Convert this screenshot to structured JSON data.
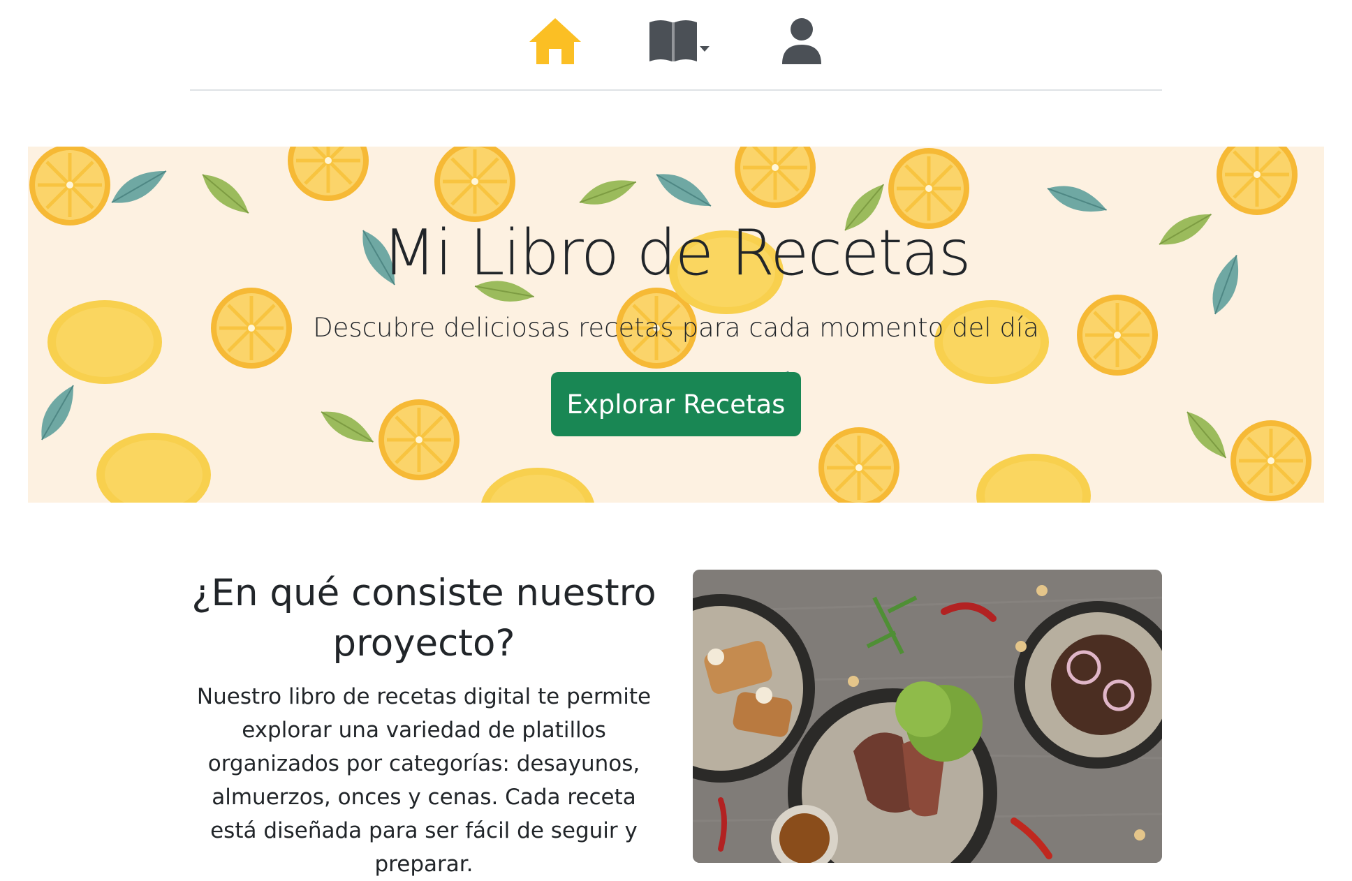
{
  "nav": {
    "home_icon": "home-icon",
    "recipes_icon": "book-open-icon",
    "recipes_dropdown_icon": "caret-down-icon",
    "user_icon": "user-icon",
    "active_color": "#fbbf24",
    "icon_color": "#4b5056"
  },
  "hero": {
    "title": "Mi Libro de Recetas",
    "subtitle": "Descubre deliciosas recetas para cada momento del día",
    "button_label": "Explorar Recetas",
    "button_color": "#198754"
  },
  "about": {
    "title": "¿En qué consiste nuestro proyecto?",
    "text": "Nuestro libro de recetas digital te permite explorar una variedad de platillos organizados por categorías: desayunos, almuerzos, onces y cenas. Cada receta está diseñada para ser fácil de seguir y preparar."
  }
}
